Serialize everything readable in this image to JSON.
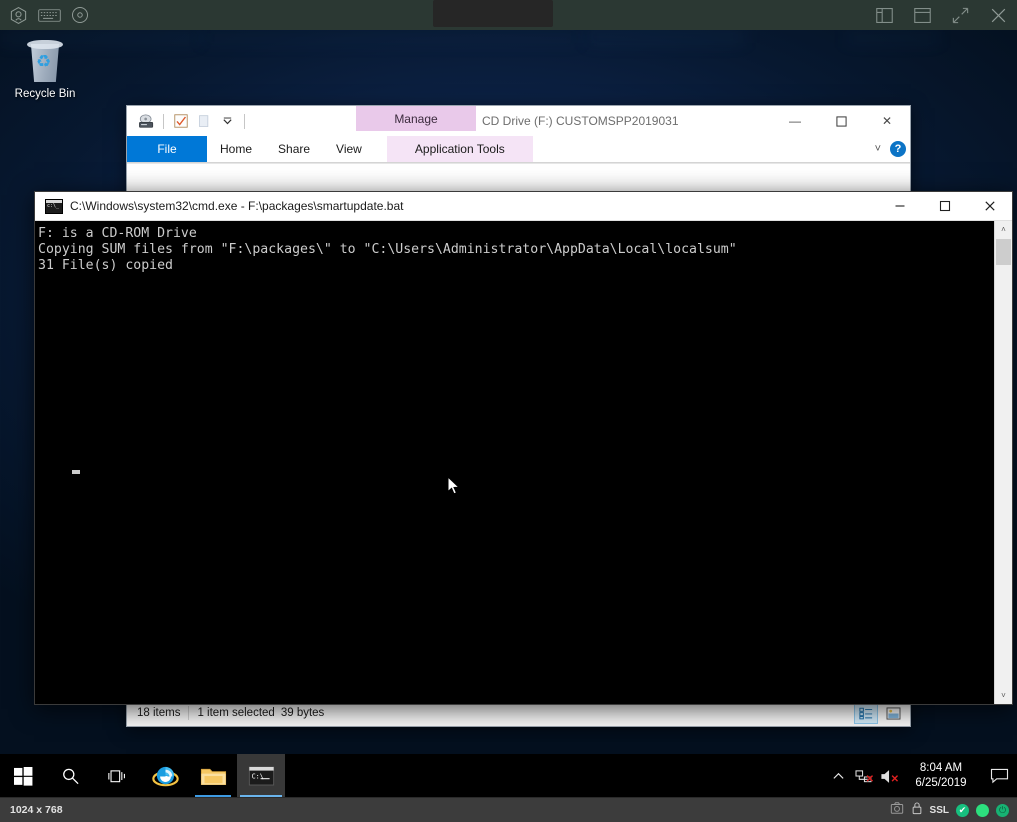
{
  "vm_toolbar": {
    "left_icons": [
      {
        "name": "vm-shield-icon",
        "label": "VM Console"
      },
      {
        "name": "keyboard-icon",
        "label": "Keyboard"
      },
      {
        "name": "disc-icon",
        "label": "Virtual Media"
      }
    ],
    "right_icons": [
      {
        "name": "layout-panel-icon",
        "label": "Toggle Panel"
      },
      {
        "name": "window-icon",
        "label": "Window Mode"
      },
      {
        "name": "fullscreen-icon",
        "label": "Full Screen"
      },
      {
        "name": "close-icon",
        "label": "Close"
      }
    ]
  },
  "desktop": {
    "recycle_bin_label": "Recycle Bin"
  },
  "explorer": {
    "title": "CD Drive (F:) CUSTOMSPP2019031",
    "contextual_group": "Manage",
    "quick_access": [
      {
        "name": "cd-drive-icon",
        "label": "CD Drive"
      },
      {
        "name": "properties-icon",
        "label": "Properties"
      },
      {
        "name": "new-folder-icon",
        "label": "New folder"
      },
      {
        "name": "customize-chevron-icon",
        "label": "Customize Quick Access Toolbar"
      }
    ],
    "tabs": [
      {
        "label": "File",
        "type": "file"
      },
      {
        "label": "Home",
        "type": "normal"
      },
      {
        "label": "Share",
        "type": "normal"
      },
      {
        "label": "View",
        "type": "normal"
      },
      {
        "label": "Application Tools",
        "type": "contextual"
      }
    ],
    "ribbon_collapse_label": "˅",
    "help_label": "?",
    "window_buttons": {
      "minimize": "—",
      "maximize": "☐",
      "close": "✕"
    },
    "status": {
      "items_count": "18 items",
      "selection": "1 item selected",
      "size": "39 bytes",
      "views": [
        {
          "name": "details-view-button",
          "label": "Details view",
          "active": true
        },
        {
          "name": "large-icons-view-button",
          "label": "Large icons view",
          "active": false
        }
      ]
    }
  },
  "cmd": {
    "title": "C:\\Windows\\system32\\cmd.exe - F:\\packages\\smartupdate.bat",
    "window_buttons": {
      "minimize": "—",
      "maximize": "☐",
      "close": "✕"
    },
    "console_lines": [
      "F: is a CD-ROM Drive",
      "Copying SUM files from \"F:\\packages\\\" to \"C:\\Users\\Administrator\\AppData\\Local\\localsum\"",
      "31 File(s) copied"
    ],
    "scrollbar": {
      "up_arrow": "˄",
      "down_arrow": "˅"
    }
  },
  "taskbar": {
    "buttons": [
      {
        "name": "start-button",
        "label": "Start"
      },
      {
        "name": "search-button",
        "label": "Search"
      },
      {
        "name": "task-view-button",
        "label": "Task View"
      }
    ],
    "apps": [
      {
        "name": "taskbar-internet-explorer",
        "label": "Internet Explorer",
        "state": "pinned"
      },
      {
        "name": "taskbar-file-explorer",
        "label": "File Explorer",
        "state": "running"
      },
      {
        "name": "taskbar-command-prompt",
        "label": "Command Prompt",
        "state": "active"
      }
    ],
    "tray": {
      "chevron": "˄",
      "network_label": "Network - no connection",
      "volume_label": "Volume - muted",
      "time": "8:04 AM",
      "date": "6/25/2019",
      "notifications_label": "Notifications"
    }
  },
  "bottom_bar": {
    "resolution": "1024 x 768",
    "camera_label": "Screenshot",
    "ssl_label": "SSL",
    "indicators": [
      {
        "name": "status-ok-indicator",
        "glyph": "✔"
      },
      {
        "name": "status-active-indicator",
        "glyph": ""
      },
      {
        "name": "power-indicator",
        "glyph": "⏻"
      }
    ]
  },
  "colors": {
    "accent_blue": "#0078d7",
    "contextual_purple": "#e9c9ea",
    "console_bg": "#000000",
    "console_fg": "#cccccc",
    "green_status": "#2ce07e"
  }
}
